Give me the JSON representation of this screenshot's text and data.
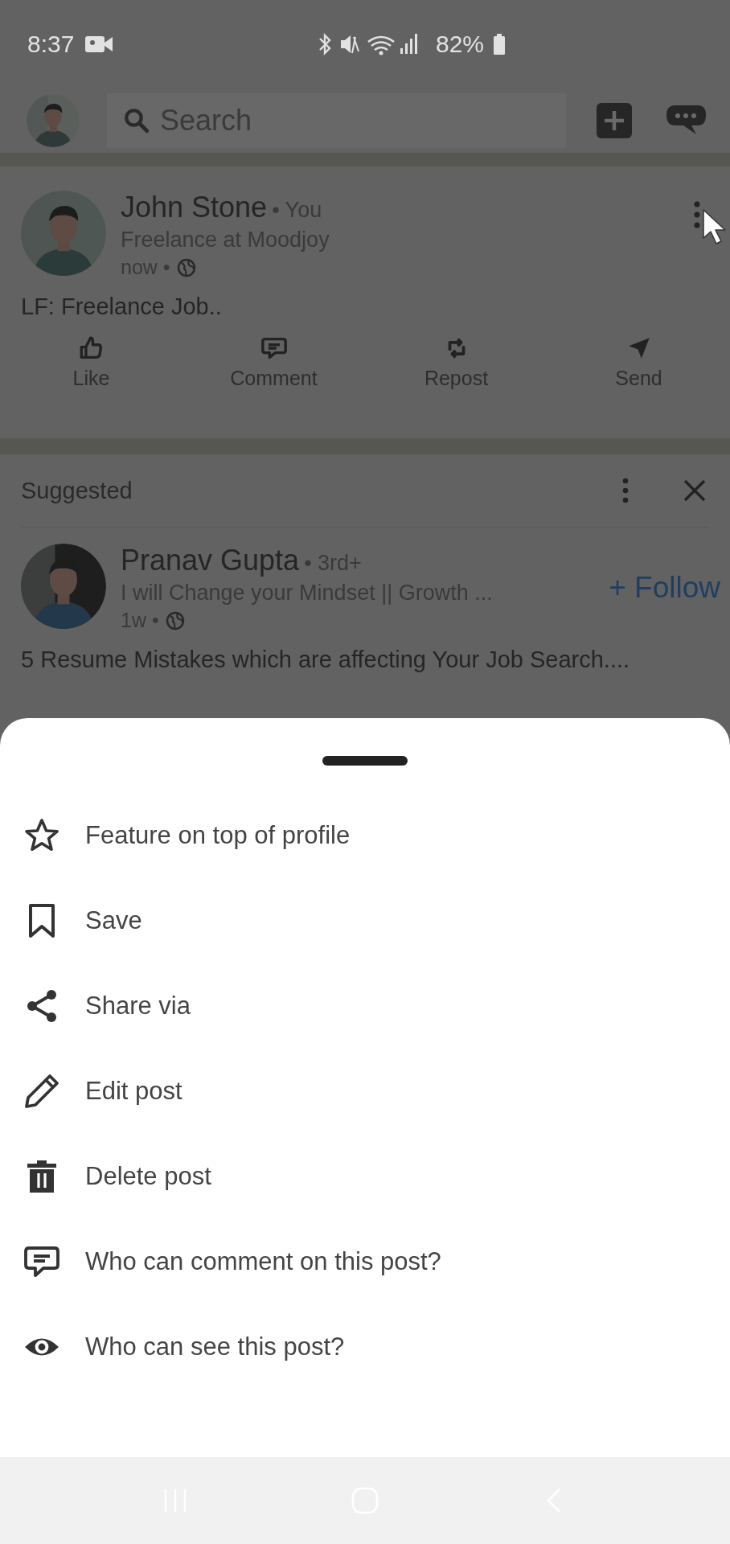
{
  "status_bar": {
    "time": "8:37",
    "battery": "82%"
  },
  "top_bar": {
    "search": {
      "placeholder": "Search"
    }
  },
  "post": {
    "author": "John Stone",
    "relation": "• You",
    "headline": "Freelance at Moodjoy",
    "time": "now •",
    "text": "LF: Freelance Job..",
    "actions": [
      {
        "label": "Like",
        "kind": "like"
      },
      {
        "label": "Comment",
        "kind": "comment"
      },
      {
        "label": "Repost",
        "kind": "repost"
      },
      {
        "label": "Send",
        "kind": "send"
      }
    ]
  },
  "suggested": {
    "title": "Suggested",
    "author": "Pranav Gupta",
    "relation": "• 3rd+",
    "headline": "I will Change your Mindset || Growth ...",
    "time": "1w •",
    "follow": "+ Follow",
    "text": "5 Resume Mistakes which are affecting Your Job Search...."
  },
  "menu": [
    {
      "label": "Feature on top of profile",
      "kind": "star"
    },
    {
      "label": "Save",
      "kind": "bookmark"
    },
    {
      "label": "Share via",
      "kind": "share"
    },
    {
      "label": "Edit post",
      "kind": "pencil"
    },
    {
      "label": "Delete post",
      "kind": "trash"
    },
    {
      "label": "Who can comment on this post?",
      "kind": "comment"
    },
    {
      "label": "Who can see this post?",
      "kind": "eye"
    }
  ]
}
